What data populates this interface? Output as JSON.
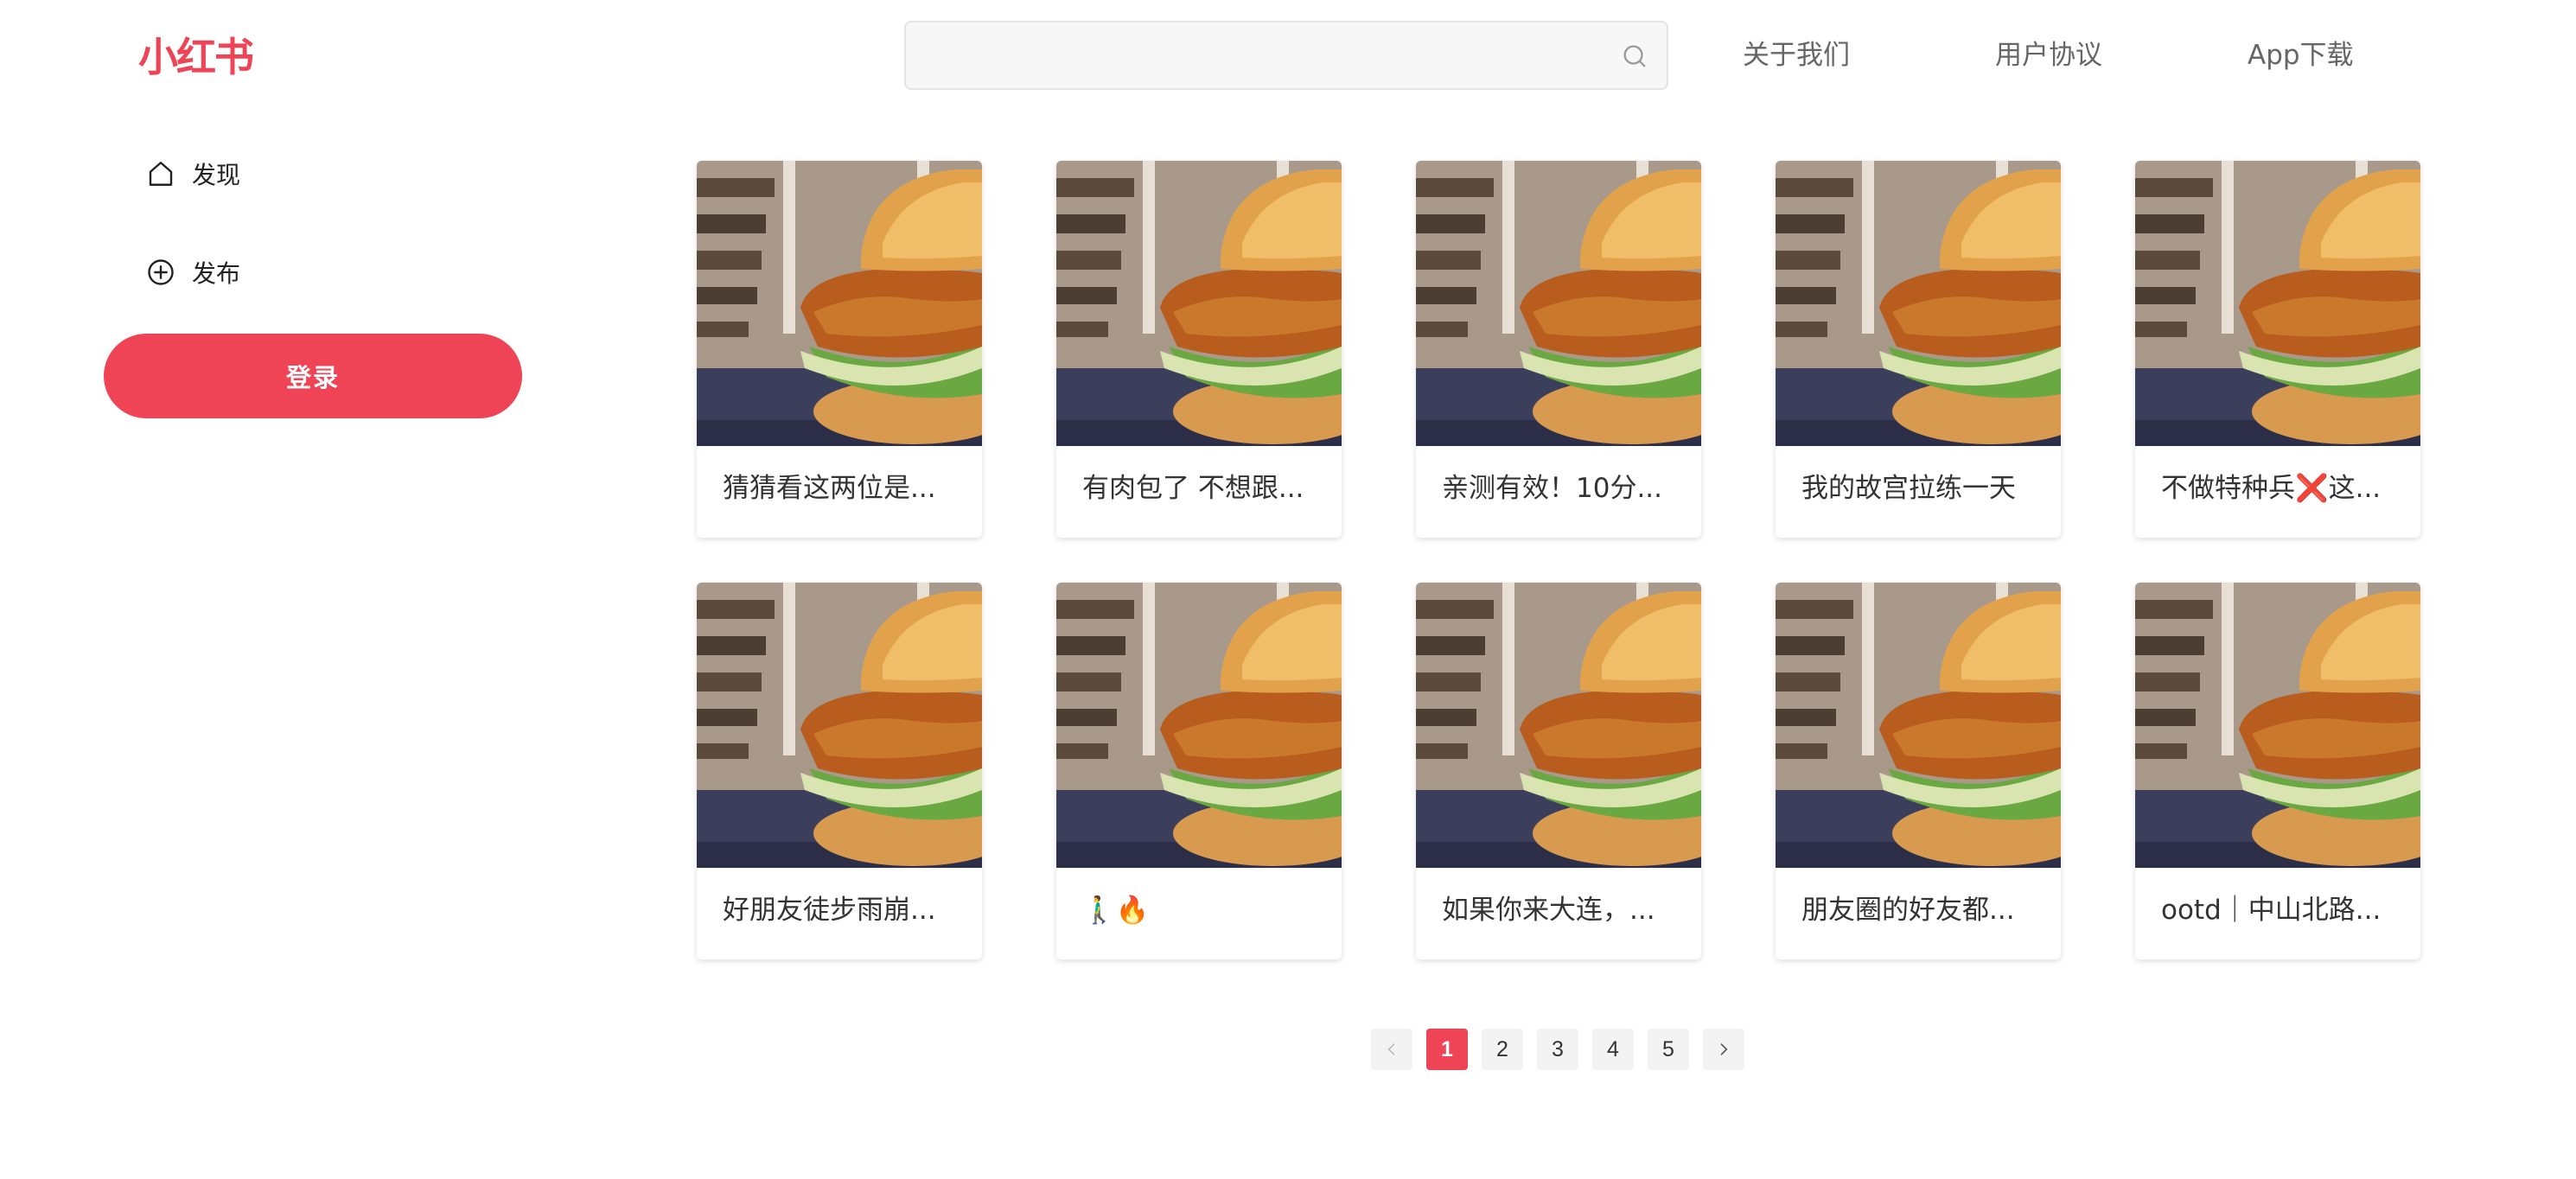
{
  "header": {
    "logo": "小红书",
    "search": {
      "value": "",
      "placeholder": ""
    },
    "links": [
      {
        "label": "关于我们"
      },
      {
        "label": "用户协议"
      },
      {
        "label": "App下载"
      }
    ]
  },
  "sidebar": {
    "items": [
      {
        "label": "发现",
        "icon": "home-icon"
      },
      {
        "label": "发布",
        "icon": "plus-circle-icon"
      }
    ],
    "login_label": "登录"
  },
  "feed": {
    "cards": [
      {
        "title": "猜猜看这两位是..."
      },
      {
        "title": "有肉包了 不想跟..."
      },
      {
        "title": "亲测有效！10分..."
      },
      {
        "title": "我的故宫拉练一天"
      },
      {
        "title": "不做特种兵❌这..."
      },
      {
        "title": "好朋友徒步雨崩..."
      },
      {
        "title": "🚶‍♂️🔥"
      },
      {
        "title": "如果你来大连，..."
      },
      {
        "title": "朋友圈的好友都..."
      },
      {
        "title": "ootd｜中山北路..."
      }
    ]
  },
  "pagination": {
    "prev_icon": "chevron-left-icon",
    "next_icon": "chevron-right-icon",
    "pages": [
      "1",
      "2",
      "3",
      "4",
      "5"
    ],
    "current": "1"
  },
  "colors": {
    "accent": "#ef4456"
  }
}
